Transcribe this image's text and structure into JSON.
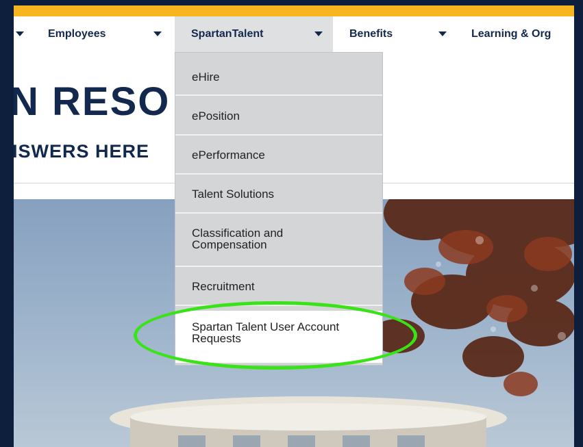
{
  "nav": {
    "items": [
      {
        "label": "Employees"
      },
      {
        "label": "SpartanTalent"
      },
      {
        "label": "Benefits"
      },
      {
        "label": "Learning & Org"
      }
    ]
  },
  "page": {
    "title_partial": "N RESO",
    "subtitle_partial": "ISWERS HERE"
  },
  "dropdown": {
    "items": [
      {
        "label": "eHire"
      },
      {
        "label": "ePosition"
      },
      {
        "label": "ePerformance"
      },
      {
        "label": "Talent Solutions"
      },
      {
        "label_line1": "Classification and",
        "label_line2": "Compensation"
      },
      {
        "label": "Recruitment"
      },
      {
        "label_line1": "Spartan Talent User Account",
        "label_line2": "Requests"
      }
    ]
  },
  "colors": {
    "navy": "#12284c",
    "gold": "#f7b51f",
    "annotation": "#3ae317"
  }
}
